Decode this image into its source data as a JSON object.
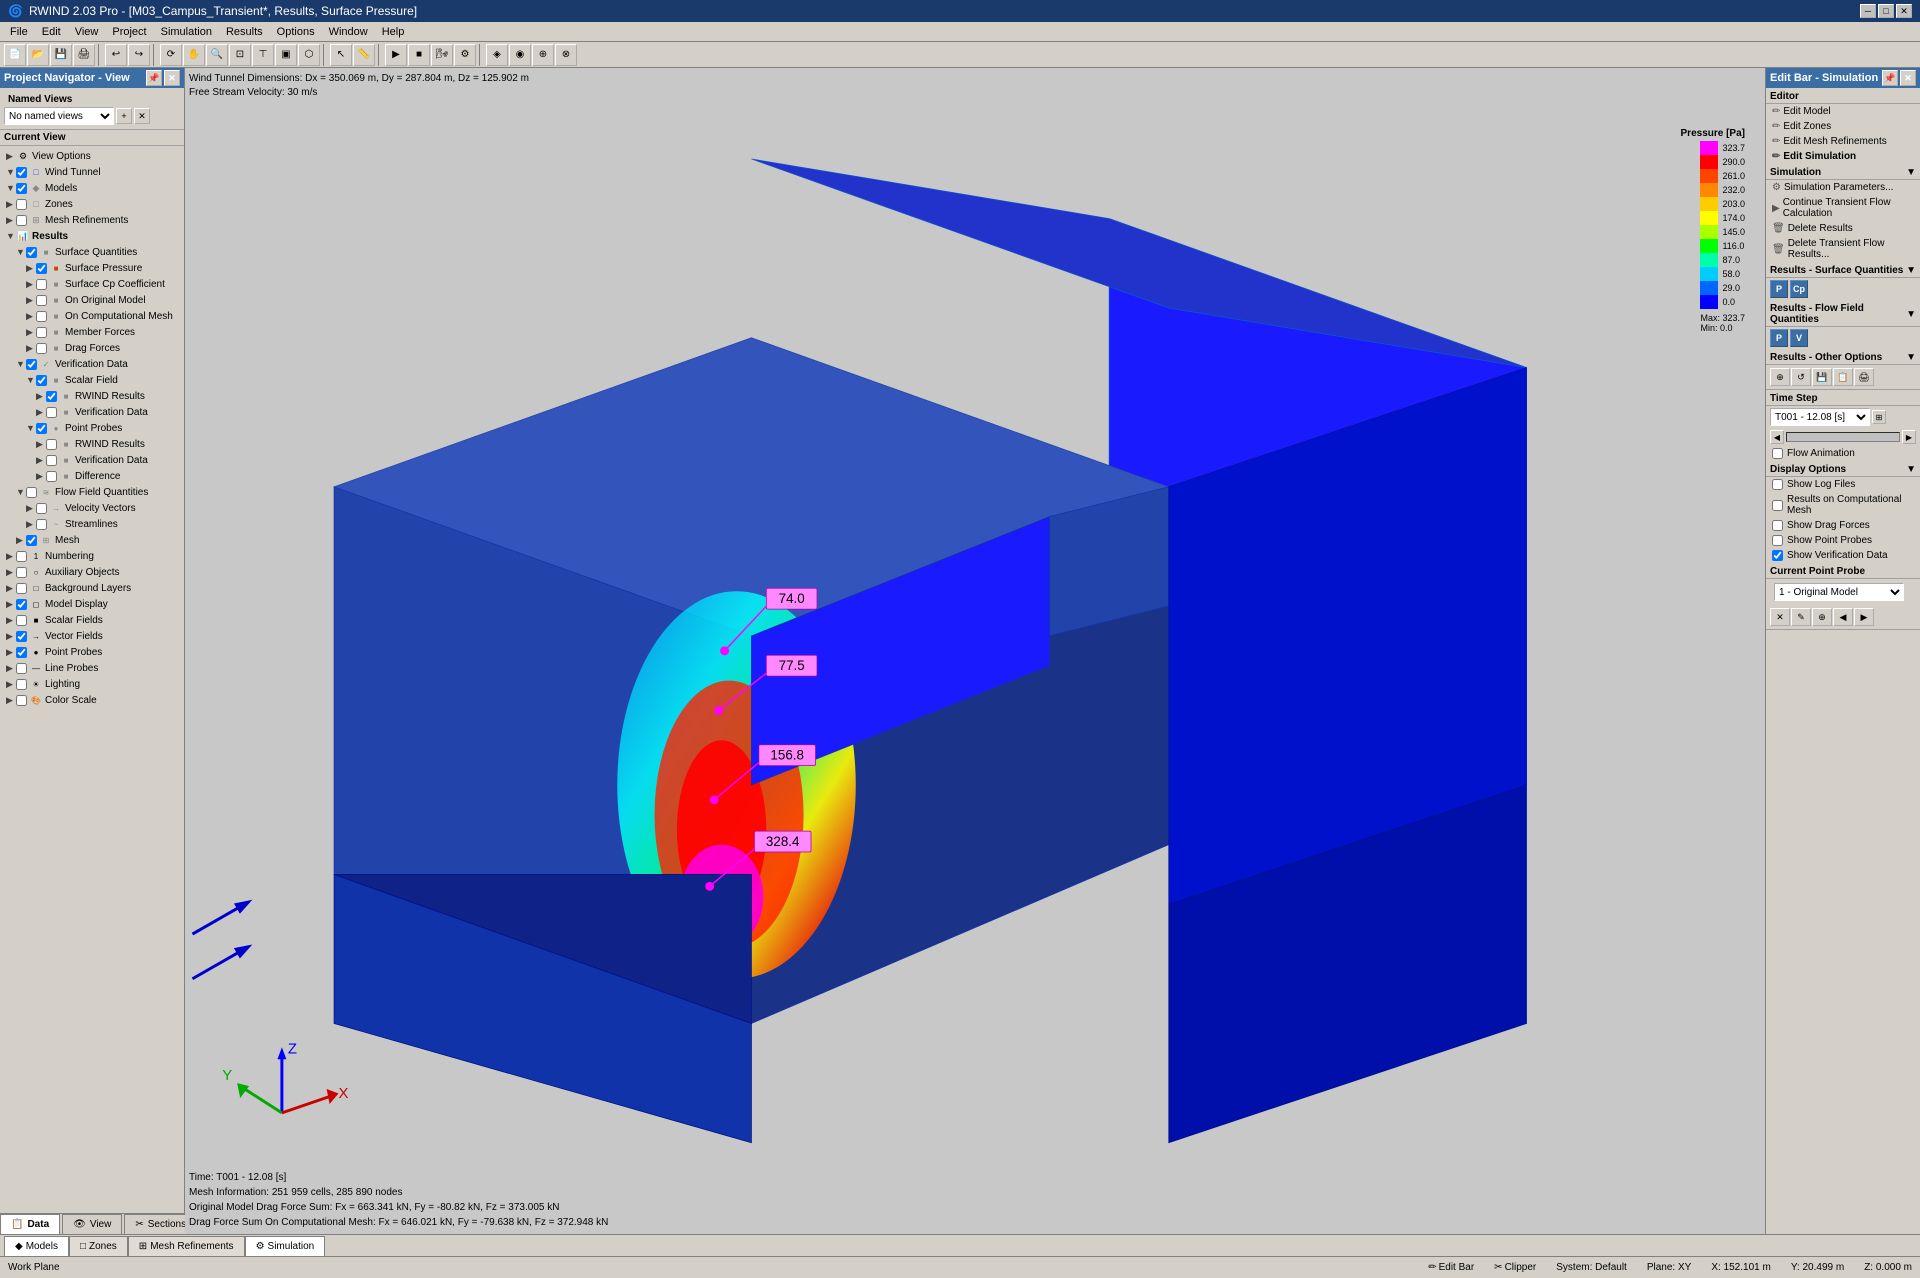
{
  "titlebar": {
    "title": "RWIND 2.03 Pro - [M03_Campus_Transient*, Results, Surface Pressure]",
    "btn_min": "─",
    "btn_max": "□",
    "btn_close": "✕",
    "btn_min2": "─",
    "btn_max2": "□",
    "btn_close2": "✕"
  },
  "menubar": {
    "items": [
      "File",
      "Edit",
      "View",
      "Project",
      "Simulation",
      "Results",
      "Options",
      "Window",
      "Help"
    ]
  },
  "left_panel": {
    "title": "Project Navigator - View",
    "named_views_label": "Named Views",
    "named_views_placeholder": "No named views",
    "current_view_label": "Current View",
    "tree": [
      {
        "id": "view-options",
        "indent": 0,
        "expand": "▶",
        "checked": null,
        "icon": "⚙",
        "text": "View Options",
        "bold": false
      },
      {
        "id": "wind-tunnel",
        "indent": 0,
        "expand": "▼",
        "checked": true,
        "icon": "□",
        "text": "Wind Tunnel",
        "bold": false
      },
      {
        "id": "models",
        "indent": 0,
        "expand": "▼",
        "checked": true,
        "icon": "◆",
        "text": "Models",
        "bold": false
      },
      {
        "id": "zones",
        "indent": 0,
        "expand": "▶",
        "checked": false,
        "icon": "□",
        "text": "Zones",
        "bold": false
      },
      {
        "id": "mesh-refinements",
        "indent": 0,
        "expand": "▶",
        "checked": false,
        "icon": "□",
        "text": "Mesh Refinements",
        "bold": false
      },
      {
        "id": "results",
        "indent": 0,
        "expand": "▼",
        "checked": null,
        "icon": "📊",
        "text": "Results",
        "bold": true
      },
      {
        "id": "surface-quantities",
        "indent": 1,
        "expand": "▼",
        "checked": true,
        "icon": "■",
        "text": "Surface Quantities",
        "bold": false
      },
      {
        "id": "surface-pressure",
        "indent": 2,
        "expand": "▶",
        "checked": true,
        "icon": "■",
        "text": "Surface Pressure",
        "bold": false
      },
      {
        "id": "surface-cp",
        "indent": 2,
        "expand": "▶",
        "checked": false,
        "icon": "■",
        "text": "Surface Cp Coefficient",
        "bold": false
      },
      {
        "id": "on-original-model",
        "indent": 2,
        "expand": "▶",
        "checked": false,
        "icon": "■",
        "text": "On Original Model",
        "bold": false
      },
      {
        "id": "on-comp-mesh",
        "indent": 2,
        "expand": "▶",
        "checked": false,
        "icon": "■",
        "text": "On Computational Mesh",
        "bold": false
      },
      {
        "id": "member-forces",
        "indent": 2,
        "expand": "▶",
        "checked": false,
        "icon": "■",
        "text": "Member Forces",
        "bold": false
      },
      {
        "id": "drag-forces",
        "indent": 2,
        "expand": "▶",
        "checked": false,
        "icon": "■",
        "text": "Drag Forces",
        "bold": false
      },
      {
        "id": "verification-data",
        "indent": 1,
        "expand": "▼",
        "checked": true,
        "icon": "✓",
        "text": "Verification Data",
        "bold": false
      },
      {
        "id": "scalar-field",
        "indent": 2,
        "expand": "▼",
        "checked": true,
        "icon": "■",
        "text": "Scalar Field",
        "bold": false
      },
      {
        "id": "rwind-results-1",
        "indent": 3,
        "expand": "▶",
        "checked": true,
        "icon": "■",
        "text": "RWIND Results",
        "bold": false
      },
      {
        "id": "verif-data-1",
        "indent": 3,
        "expand": "▶",
        "checked": false,
        "icon": "■",
        "text": "Verification Data",
        "bold": false
      },
      {
        "id": "point-probes-verif",
        "indent": 2,
        "expand": "▼",
        "checked": true,
        "icon": "●",
        "text": "Point Probes",
        "bold": false
      },
      {
        "id": "rwind-results-2",
        "indent": 3,
        "expand": "▶",
        "checked": false,
        "icon": "■",
        "text": "RWIND Results",
        "bold": false
      },
      {
        "id": "verif-data-2",
        "indent": 3,
        "expand": "▶",
        "checked": false,
        "icon": "■",
        "text": "Verification Data",
        "bold": false
      },
      {
        "id": "difference",
        "indent": 3,
        "expand": "▶",
        "checked": false,
        "icon": "■",
        "text": "Difference",
        "bold": false
      },
      {
        "id": "flow-field-quantities",
        "indent": 1,
        "expand": "▼",
        "checked": false,
        "icon": "≋",
        "text": "Flow Field Quantities",
        "bold": false
      },
      {
        "id": "velocity-vectors",
        "indent": 2,
        "expand": "▶",
        "checked": false,
        "icon": "→",
        "text": "Velocity Vectors",
        "bold": false
      },
      {
        "id": "streamlines",
        "indent": 2,
        "expand": "▶",
        "checked": false,
        "icon": "~",
        "text": "Streamlines",
        "bold": false
      },
      {
        "id": "mesh",
        "indent": 1,
        "expand": "▶",
        "checked": true,
        "icon": "⊞",
        "text": "Mesh",
        "bold": false
      },
      {
        "id": "numbering",
        "indent": 0,
        "expand": "▶",
        "checked": false,
        "icon": "1",
        "text": "Numbering",
        "bold": false
      },
      {
        "id": "auxiliary-objects",
        "indent": 0,
        "expand": "▶",
        "checked": false,
        "icon": "○",
        "text": "Auxiliary Objects",
        "bold": false
      },
      {
        "id": "background-layers",
        "indent": 0,
        "expand": "▶",
        "checked": false,
        "icon": "□",
        "text": "Background Layers",
        "bold": false
      },
      {
        "id": "model-display",
        "indent": 0,
        "expand": "▶",
        "checked": true,
        "icon": "◻",
        "text": "Model Display",
        "bold": false
      },
      {
        "id": "scalar-fields",
        "indent": 0,
        "expand": "▶",
        "checked": false,
        "icon": "■",
        "text": "Scalar Fields",
        "bold": false
      },
      {
        "id": "vector-fields",
        "indent": 0,
        "expand": "▶",
        "checked": true,
        "icon": "→",
        "text": "Vector Fields",
        "bold": false
      },
      {
        "id": "point-probes",
        "indent": 0,
        "expand": "▶",
        "checked": true,
        "icon": "●",
        "text": "Point Probes",
        "bold": false
      },
      {
        "id": "line-probes",
        "indent": 0,
        "expand": "▶",
        "checked": false,
        "icon": "—",
        "text": "Line Probes",
        "bold": false
      },
      {
        "id": "lighting",
        "indent": 0,
        "expand": "▶",
        "checked": false,
        "icon": "☀",
        "text": "Lighting",
        "bold": false
      },
      {
        "id": "color-scale",
        "indent": 0,
        "expand": "▶",
        "checked": false,
        "icon": "🎨",
        "text": "Color Scale",
        "bold": false
      }
    ]
  },
  "viewport": {
    "info_line1": "Wind Tunnel Dimensions: Dx = 350.069 m, Dy = 287.804 m, Dz = 125.902 m",
    "info_line2": "Free Stream Velocity: 30 m/s",
    "pressure_label": "Pressure [Pa]",
    "pressure_values": [
      "323.7",
      "290.0",
      "261.0",
      "232.0",
      "203.0",
      "174.0",
      "145.0",
      "116.0",
      "87.0",
      "58.0",
      "29.0",
      "0.0"
    ],
    "pressure_colors": [
      "#ff00ff",
      "#ff0000",
      "#ff4400",
      "#ff8800",
      "#ffcc00",
      "#ffff00",
      "#aaff00",
      "#00ff00",
      "#00ffaa",
      "#00ccff",
      "#0066ff",
      "#0000ff"
    ],
    "max_label": "Max:",
    "max_value": "323.7",
    "min_label": "Min:",
    "min_value": "0.0",
    "probe_values": [
      "74.0",
      "77.5",
      "156.8",
      "328.4"
    ],
    "status_line1": "Time: T001 - 12.08 [s]",
    "status_line2": "Mesh Information: 251 959 cells, 285 890 nodes",
    "status_line3": "Original Model Drag Force Sum: Fx = 663.341 kN, Fy = -80.82 kN, Fz = 373.005 kN",
    "status_line4": "Drag Force Sum On Computational Mesh: Fx = 646.021 kN, Fy = -79.638 kN, Fz = 372.948 kN"
  },
  "right_panel": {
    "title": "Edit Bar - Simulation",
    "editor_label": "Editor",
    "edit_model": "Edit Model",
    "edit_zones": "Edit Zones",
    "edit_mesh_refinements": "Edit Mesh Refinements",
    "edit_simulation": "Edit Simulation",
    "simulation_label": "Simulation",
    "simulation_parameters": "Simulation Parameters...",
    "continue_transient": "Continue Transient Flow Calculation",
    "delete_results": "Delete Results",
    "delete_transient": "Delete Transient Flow Results...",
    "results_surface_label": "Results - Surface Quantities",
    "p_btn": "P",
    "cp_btn": "Cp",
    "results_flow_label": "Results - Flow Field Quantities",
    "p_btn2": "P",
    "v_btn2": "V",
    "results_other_label": "Results - Other Options",
    "time_step_label": "Time Step",
    "time_step_value": "T001 - 12.08 [s]",
    "flow_animation_label": "Flow Animation",
    "display_options_label": "Display Options",
    "show_log_files": "Show Log Files",
    "results_on_comp_mesh": "Results on Computational Mesh",
    "show_drag_forces": "Show Drag Forces",
    "show_point_probes": "Show Point Probes",
    "show_verification_data": "Show Verification Data",
    "current_point_probe_label": "Current Point Probe",
    "current_point_probe_value": "1 - Original Model"
  },
  "bottom_tabs": {
    "items": [
      "Models",
      "Zones",
      "Mesh Refinements",
      "Simulation"
    ],
    "active": "Simulation",
    "icons": [
      "◆",
      "□",
      "⊞",
      "⚙"
    ]
  },
  "left_bottom_tabs": {
    "items": [
      "Data",
      "View",
      "Sections"
    ],
    "icons": [
      "📋",
      "👁",
      "✂"
    ]
  },
  "statusbar": {
    "left": "Work Plane",
    "edit_bar": "Edit Bar",
    "clipper": "Clipper",
    "system": "System: Default",
    "plane": "Plane: XY",
    "x": "X: 152.101 m",
    "y": "Y: 20.499 m",
    "z": "Z: 0.000 m"
  }
}
